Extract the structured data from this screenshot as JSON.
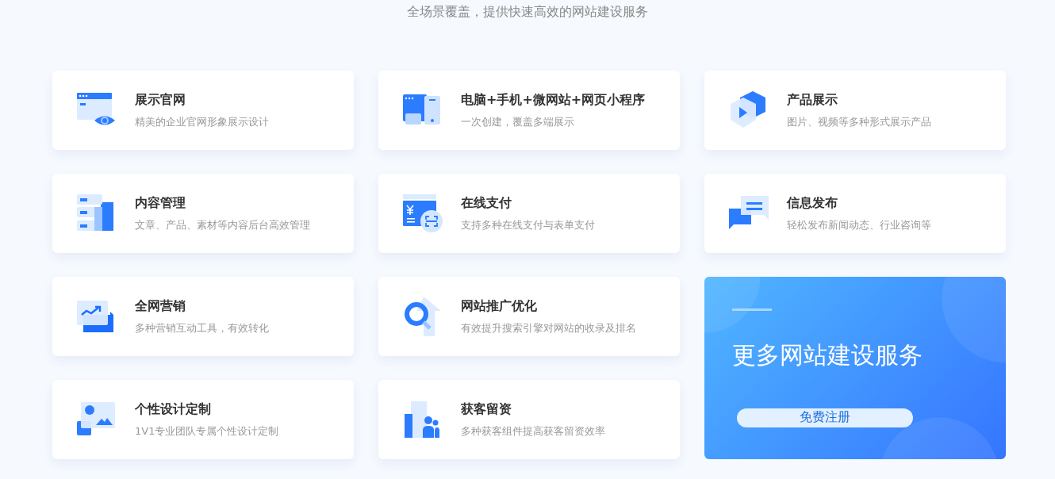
{
  "subtitle": "全场景覆盖，提供快速高效的网站建设服务",
  "services": [
    {
      "kind": "website",
      "title": "展示官网",
      "description": "精美的企业官网形象展示设计"
    },
    {
      "kind": "devices",
      "title": "电脑+手机+微网站+网页小程序",
      "description": "一次创建，覆盖多端展示"
    },
    {
      "kind": "product",
      "title": "产品展示",
      "description": "图片、视频等多种形式展示产品"
    },
    {
      "kind": "content",
      "title": "内容管理",
      "description": "文章、产品、素材等内容后台高效管理"
    },
    {
      "kind": "payment",
      "title": "在线支付",
      "description": "支持多种在线支付与表单支付"
    },
    {
      "kind": "publish",
      "title": "信息发布",
      "description": "轻松发布新闻动态、行业咨询等"
    },
    {
      "kind": "marketing",
      "title": "全网营销",
      "description": "多种营销互动工具，有效转化"
    },
    {
      "kind": "seo",
      "title": "网站推广优化",
      "description": "有效提升搜索引擎对网站的收录及排名"
    },
    {
      "kind": "design",
      "title": "个性设计定制",
      "description": "1V1专业团队专属个性设计定制"
    },
    {
      "kind": "leads",
      "title": "获客留资",
      "description": "多种获客组件提高获客留资效率"
    }
  ],
  "promo": {
    "title": "更多网站建设服务",
    "button": "免费注册"
  }
}
